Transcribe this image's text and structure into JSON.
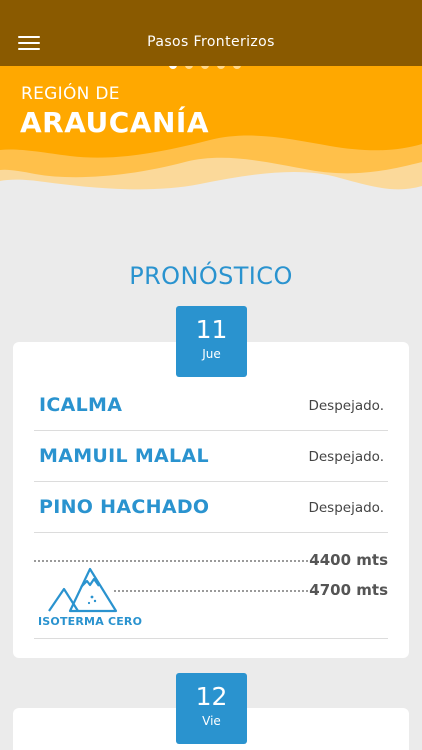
{
  "header": {
    "title": "Pasos Fronterizos",
    "menu_icon": "hamburger-menu-icon"
  },
  "carousel": {
    "page_count": 5,
    "active_index": 0
  },
  "region": {
    "prefix": "REGIÓN DE",
    "name": "ARAUCANÍA"
  },
  "section": {
    "title": "PRONÓSTICO"
  },
  "days": [
    {
      "day": "11",
      "weekday": "Jue",
      "passes": [
        {
          "name": "ICALMA",
          "status": "Despejado."
        },
        {
          "name": "MAMUIL MALAL",
          "status": "Despejado."
        },
        {
          "name": "PINO HACHADO",
          "status": "Despejado."
        }
      ],
      "isotherm": {
        "label": "ISOTERMA CERO",
        "values": [
          "4400 mts",
          "4700 mts"
        ],
        "icon": "mountain-icon"
      }
    },
    {
      "day": "12",
      "weekday": "Vie"
    }
  ],
  "colors": {
    "topbar": "#8a5a00",
    "hero": "#ffa800",
    "accent": "#2a93cf",
    "background": "#ebebeb"
  }
}
